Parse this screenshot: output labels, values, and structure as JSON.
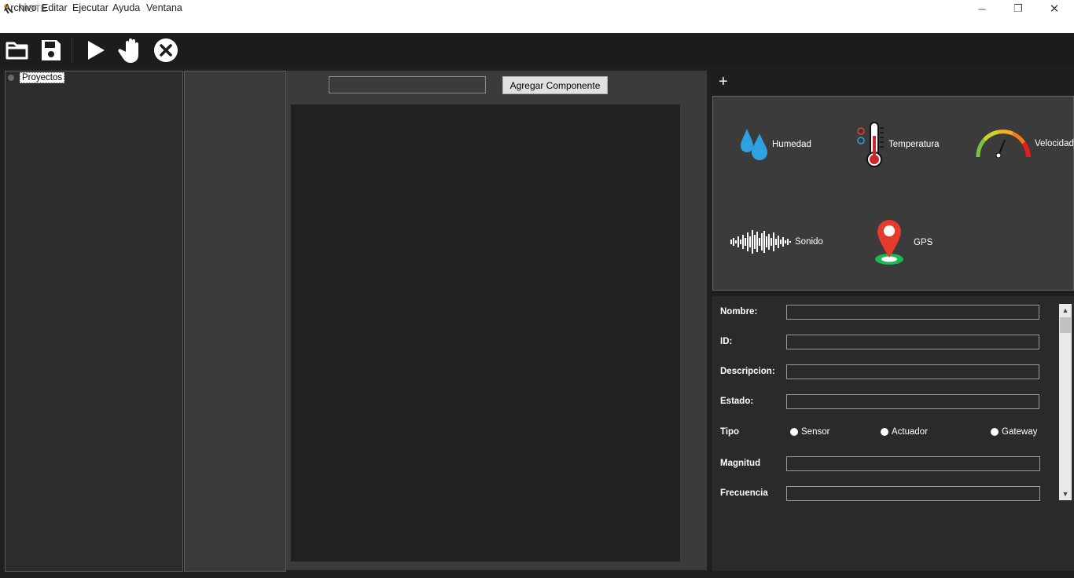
{
  "window": {
    "title": "NIOTE",
    "minimize": "─",
    "restore": "❐",
    "close": "✕"
  },
  "menu": [
    "Archivo",
    "Editar",
    "Ejecutar",
    "Ayuda",
    "Ventana"
  ],
  "toolbar": {
    "open": "folder-open-icon",
    "save": "save-icon",
    "run": "play-icon",
    "stop": "hand-stop-icon",
    "close": "close-circle-icon"
  },
  "tree": {
    "root": "Proyectos"
  },
  "component": {
    "input_value": "",
    "add_label": "Agregar Componente"
  },
  "right_tabs": {
    "add": "+"
  },
  "components": [
    {
      "label": "Humedad",
      "icon": "water-drops-icon"
    },
    {
      "label": "Temperatura",
      "icon": "thermometer-icon"
    },
    {
      "label": "Velocidad",
      "icon": "speedometer-icon"
    },
    {
      "label": "Sonido",
      "icon": "sound-wave-icon"
    },
    {
      "label": "GPS",
      "icon": "map-pin-icon"
    }
  ],
  "properties": {
    "nombre": "Nombre:",
    "id": "ID:",
    "descripcion": "Descripcion:",
    "estado": "Estado:",
    "tipo": "Tipo",
    "tipo_options": [
      "Sensor",
      "Actuador",
      "Gateway"
    ],
    "magnitud": "Magnitud",
    "frecuencia": "Frecuencia"
  },
  "colors": {
    "accent_blue": "#2fa0e0",
    "pin_red": "#e53b2c",
    "pin_green": "#1db954"
  }
}
